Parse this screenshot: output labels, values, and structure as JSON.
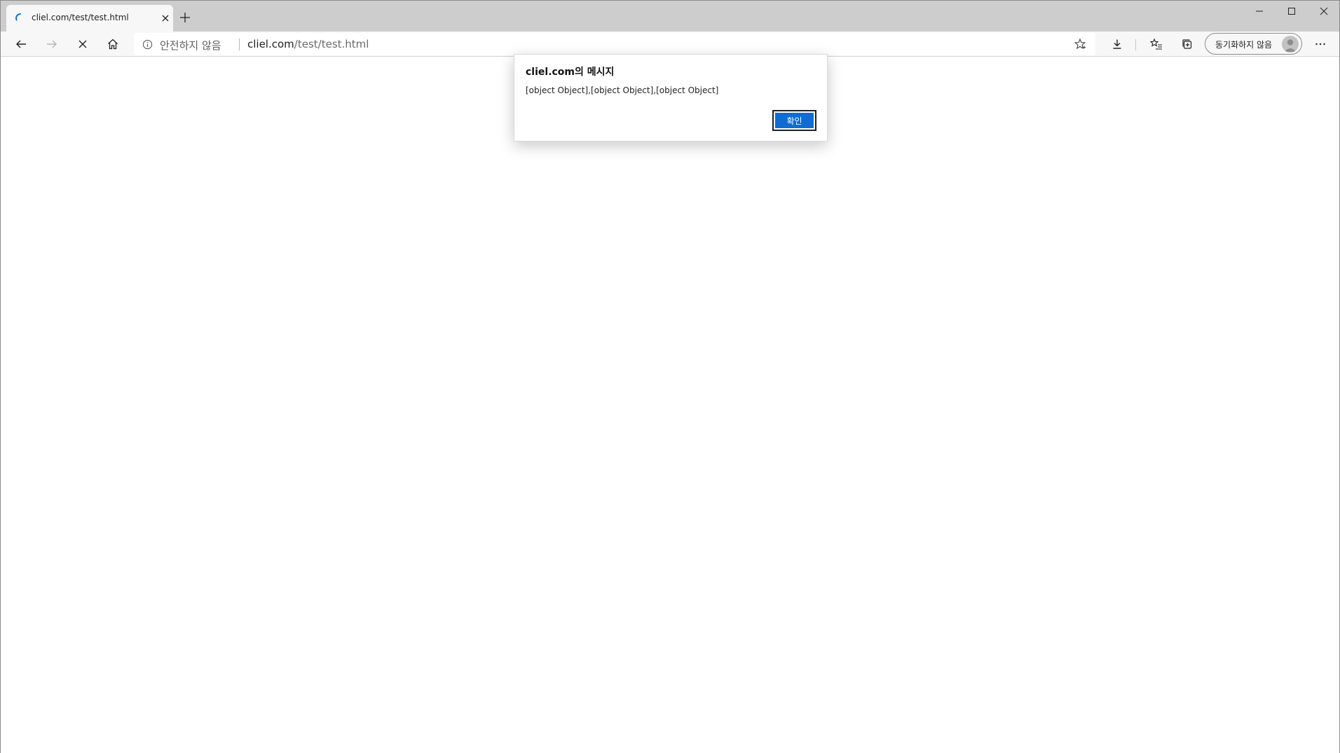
{
  "browser": {
    "tab": {
      "title": "cliel.com/test/test.html"
    },
    "address": {
      "security_label": "안전하지 않음",
      "url_host": "cliel.com",
      "url_path": "/test/test.html"
    },
    "profile": {
      "sync_label": "동기화하지 않음"
    }
  },
  "dialog": {
    "title": "cliel.com의 메시지",
    "message": "[object Object],[object Object],[object Object]",
    "ok_label": "확인"
  },
  "colors": {
    "accent": "#0f6cd0",
    "tabstrip": "#cdcdcd",
    "toolbar": "#f7f7f7"
  }
}
